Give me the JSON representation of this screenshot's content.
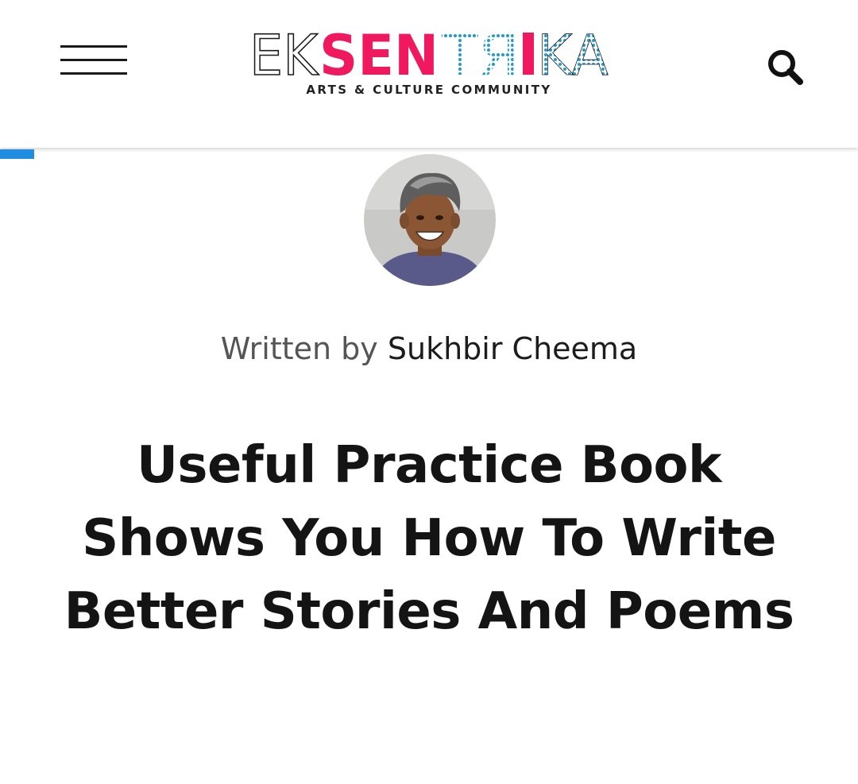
{
  "header": {
    "logo": {
      "text_part1": "EK",
      "text_part2": "SEN",
      "text_part3": "TЯI",
      "text_part4": "KA",
      "tagline": "ARTS & CULTURE COMMUNITY",
      "colors": {
        "outline": "#1a1a1a",
        "pink": "#f0185f",
        "blue": "#1f9ad6"
      }
    },
    "menu_icon": "hamburger-menu-icon",
    "search_icon": "search-icon"
  },
  "reading_progress": {
    "fraction": 0.04,
    "color": "#1f8ee0"
  },
  "article": {
    "author_avatar": "author-avatar-photo",
    "byline_prefix": "Written by",
    "author_name": "Sukhbir Cheema",
    "title": "Useful Practice Book Shows You How To Write Better Stories And Poems"
  }
}
